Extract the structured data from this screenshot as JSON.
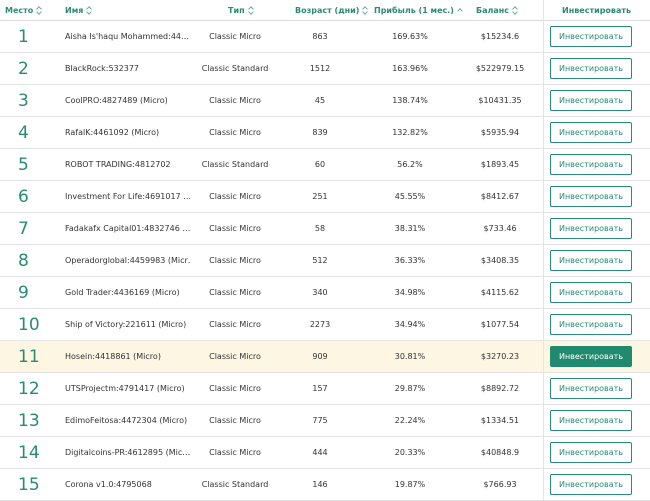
{
  "header": {
    "rank": "Место",
    "name": "Имя",
    "type": "Тип",
    "age": "Возраст (дни)",
    "profit": "Прибыль (1 мес.)",
    "balance": "Баланс",
    "invest": "Инвестировать"
  },
  "rows": [
    {
      "rank": "1",
      "name": "Aisha Is'haqu Mohammed:44…",
      "type": "Classic Micro",
      "age": "863",
      "profit": "169.63%",
      "balance": "$15234.6",
      "button": "Инвестировать"
    },
    {
      "rank": "2",
      "name": "BlackRock:532377",
      "type": "Classic Standard",
      "age": "1512",
      "profit": "163.96%",
      "balance": "$522979.15",
      "button": "Инвестировать"
    },
    {
      "rank": "3",
      "name": "CoolPRO:4827489 (Micro)",
      "type": "Classic Micro",
      "age": "45",
      "profit": "138.74%",
      "balance": "$10431.35",
      "button": "Инвестировать"
    },
    {
      "rank": "4",
      "name": "RafalK:4461092 (Micro)",
      "type": "Classic Micro",
      "age": "839",
      "profit": "132.82%",
      "balance": "$5935.94",
      "button": "Инвестировать"
    },
    {
      "rank": "5",
      "name": "ROBOT TRADING:4812702",
      "type": "Classic Standard",
      "age": "60",
      "profit": "56.2%",
      "balance": "$1893.45",
      "button": "Инвестировать"
    },
    {
      "rank": "6",
      "name": "Investment For Life:4691017 …",
      "type": "Classic Micro",
      "age": "251",
      "profit": "45.55%",
      "balance": "$8412.67",
      "button": "Инвестировать"
    },
    {
      "rank": "7",
      "name": "Fadakafx Capital01:4832746 …",
      "type": "Classic Micro",
      "age": "58",
      "profit": "38.31%",
      "balance": "$733.46",
      "button": "Инвестировать"
    },
    {
      "rank": "8",
      "name": "Operadorglobal:4459983 (Micr…",
      "type": "Classic Micro",
      "age": "512",
      "profit": "36.33%",
      "balance": "$3408.35",
      "button": "Инвестировать"
    },
    {
      "rank": "9",
      "name": "Gold Trader:4436169 (Micro)",
      "type": "Classic Micro",
      "age": "340",
      "profit": "34.98%",
      "balance": "$4115.62",
      "button": "Инвестировать"
    },
    {
      "rank": "10",
      "name": "Ship of Victory:221611 (Micro)",
      "type": "Classic Micro",
      "age": "2273",
      "profit": "34.94%",
      "balance": "$1077.54",
      "button": "Инвестировать"
    },
    {
      "rank": "11",
      "name": "Hosein:4418861 (Micro)",
      "type": "Classic Micro",
      "age": "909",
      "profit": "30.81%",
      "balance": "$3270.23",
      "button": "Инвестировать"
    },
    {
      "rank": "12",
      "name": "UTSProjectm:4791417 (Micro)",
      "type": "Classic Micro",
      "age": "157",
      "profit": "29.87%",
      "balance": "$8892.72",
      "button": "Инвестировать"
    },
    {
      "rank": "13",
      "name": "EdimoFeitosa:4472304 (Micro)",
      "type": "Classic Micro",
      "age": "775",
      "profit": "22.24%",
      "balance": "$1334.51",
      "button": "Инвестировать"
    },
    {
      "rank": "14",
      "name": "Digitalcoins-PR:4612895 (Mic…",
      "type": "Classic Micro",
      "age": "444",
      "profit": "20.33%",
      "balance": "$40848.9",
      "button": "Инвестировать"
    },
    {
      "rank": "15",
      "name": "Corona v1.0:4795068",
      "type": "Classic Standard",
      "age": "146",
      "profit": "19.87%",
      "balance": "$766.93",
      "button": "Инвестировать"
    }
  ],
  "colors": {
    "accent": "#2b8a73",
    "highlight_row": "#fdf6e3",
    "button_filled": "#1f8a6e"
  },
  "icons": {
    "sort": "sort-updown-icon",
    "sort_active": "sort-up-icon"
  }
}
